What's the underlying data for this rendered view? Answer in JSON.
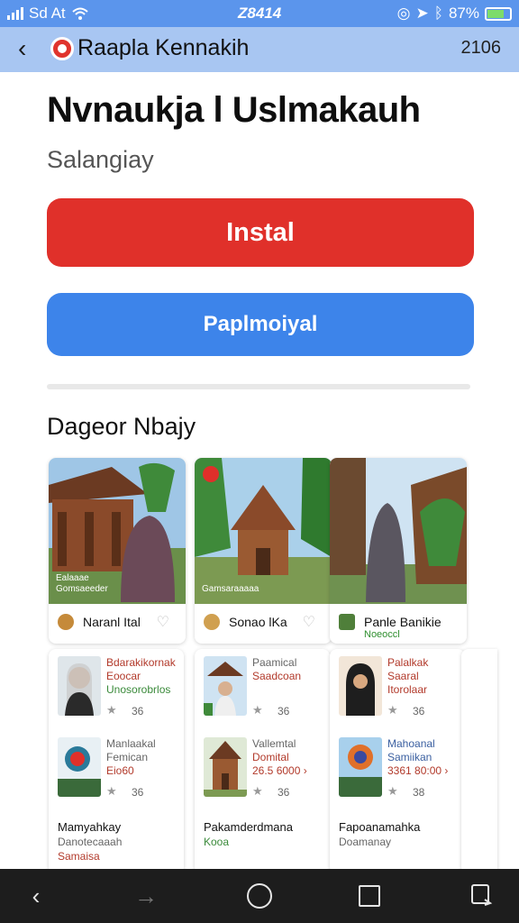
{
  "status_bar": {
    "carrier": "Sd At",
    "time": "Z8414",
    "battery": "87%",
    "signal_icon": "signal-bars-icon",
    "wifi_icon": "wifi-icon"
  },
  "app_bar": {
    "title": "Raapla Kennakih",
    "count": "2106"
  },
  "app": {
    "name": "Nvnaukja l Uslmakauh",
    "developer": "Salangiay",
    "install_label": "Instal",
    "secondary_label": "Paplmoiyal"
  },
  "section": {
    "title": "Dageor Nbajy"
  },
  "top_cards": [
    {
      "name": "Naranl Ital",
      "sub": "",
      "caption1": "Ealaaae",
      "caption2": "Gomsaeeder"
    },
    {
      "name": "Sonao lKa",
      "sub": "",
      "caption1": "",
      "caption2": "Gamsaraaaaa"
    },
    {
      "name": "Panle Banikie",
      "sub": "Noeoccl",
      "caption1": "",
      "caption2": ""
    }
  ],
  "bottom_cards": [
    {
      "items": [
        {
          "t1": "Bdarakikornak",
          "t2": "Eoocar",
          "t3": "Unosorobrlos",
          "num": "36"
        },
        {
          "t1": "Manlaakal",
          "t2": "Femican",
          "t3": "Eio60",
          "num": "36"
        }
      ],
      "foot1": "Mamyahkay",
      "foot2": "Danotecaaah",
      "foot3": "Samaisa"
    },
    {
      "items": [
        {
          "t1": "Paamical",
          "t2": "Saadcoan",
          "t3": "",
          "num": "36"
        },
        {
          "t1": "Vallemtal",
          "t2": "Domital",
          "t3": "26.5 6000 ›",
          "num": "36"
        }
      ],
      "foot1": "Pakamderdmana",
      "foot2": "Kooa",
      "foot3": ""
    },
    {
      "items": [
        {
          "t1": "Palalkak",
          "t2": "Saaral",
          "t3": "Itorolaar",
          "num": "36"
        },
        {
          "t1": "Mahoanal",
          "t2": "Samiikan",
          "t3": "3361 80:00 ›",
          "num": "38"
        }
      ],
      "foot1": "Fapoanamahka",
      "foot2": "Doamanay",
      "foot3": ""
    }
  ],
  "nav_bar": {
    "back_icon": "back-icon",
    "forward_icon": "forward-icon",
    "home_icon": "home-icon",
    "recents_icon": "recents-icon",
    "rotate_icon": "rotate-icon"
  },
  "colors": {
    "install": "#e0302a",
    "secondary": "#3d84ea",
    "status_bar": "#5b95ec",
    "app_bar": "#a8c6f2"
  }
}
